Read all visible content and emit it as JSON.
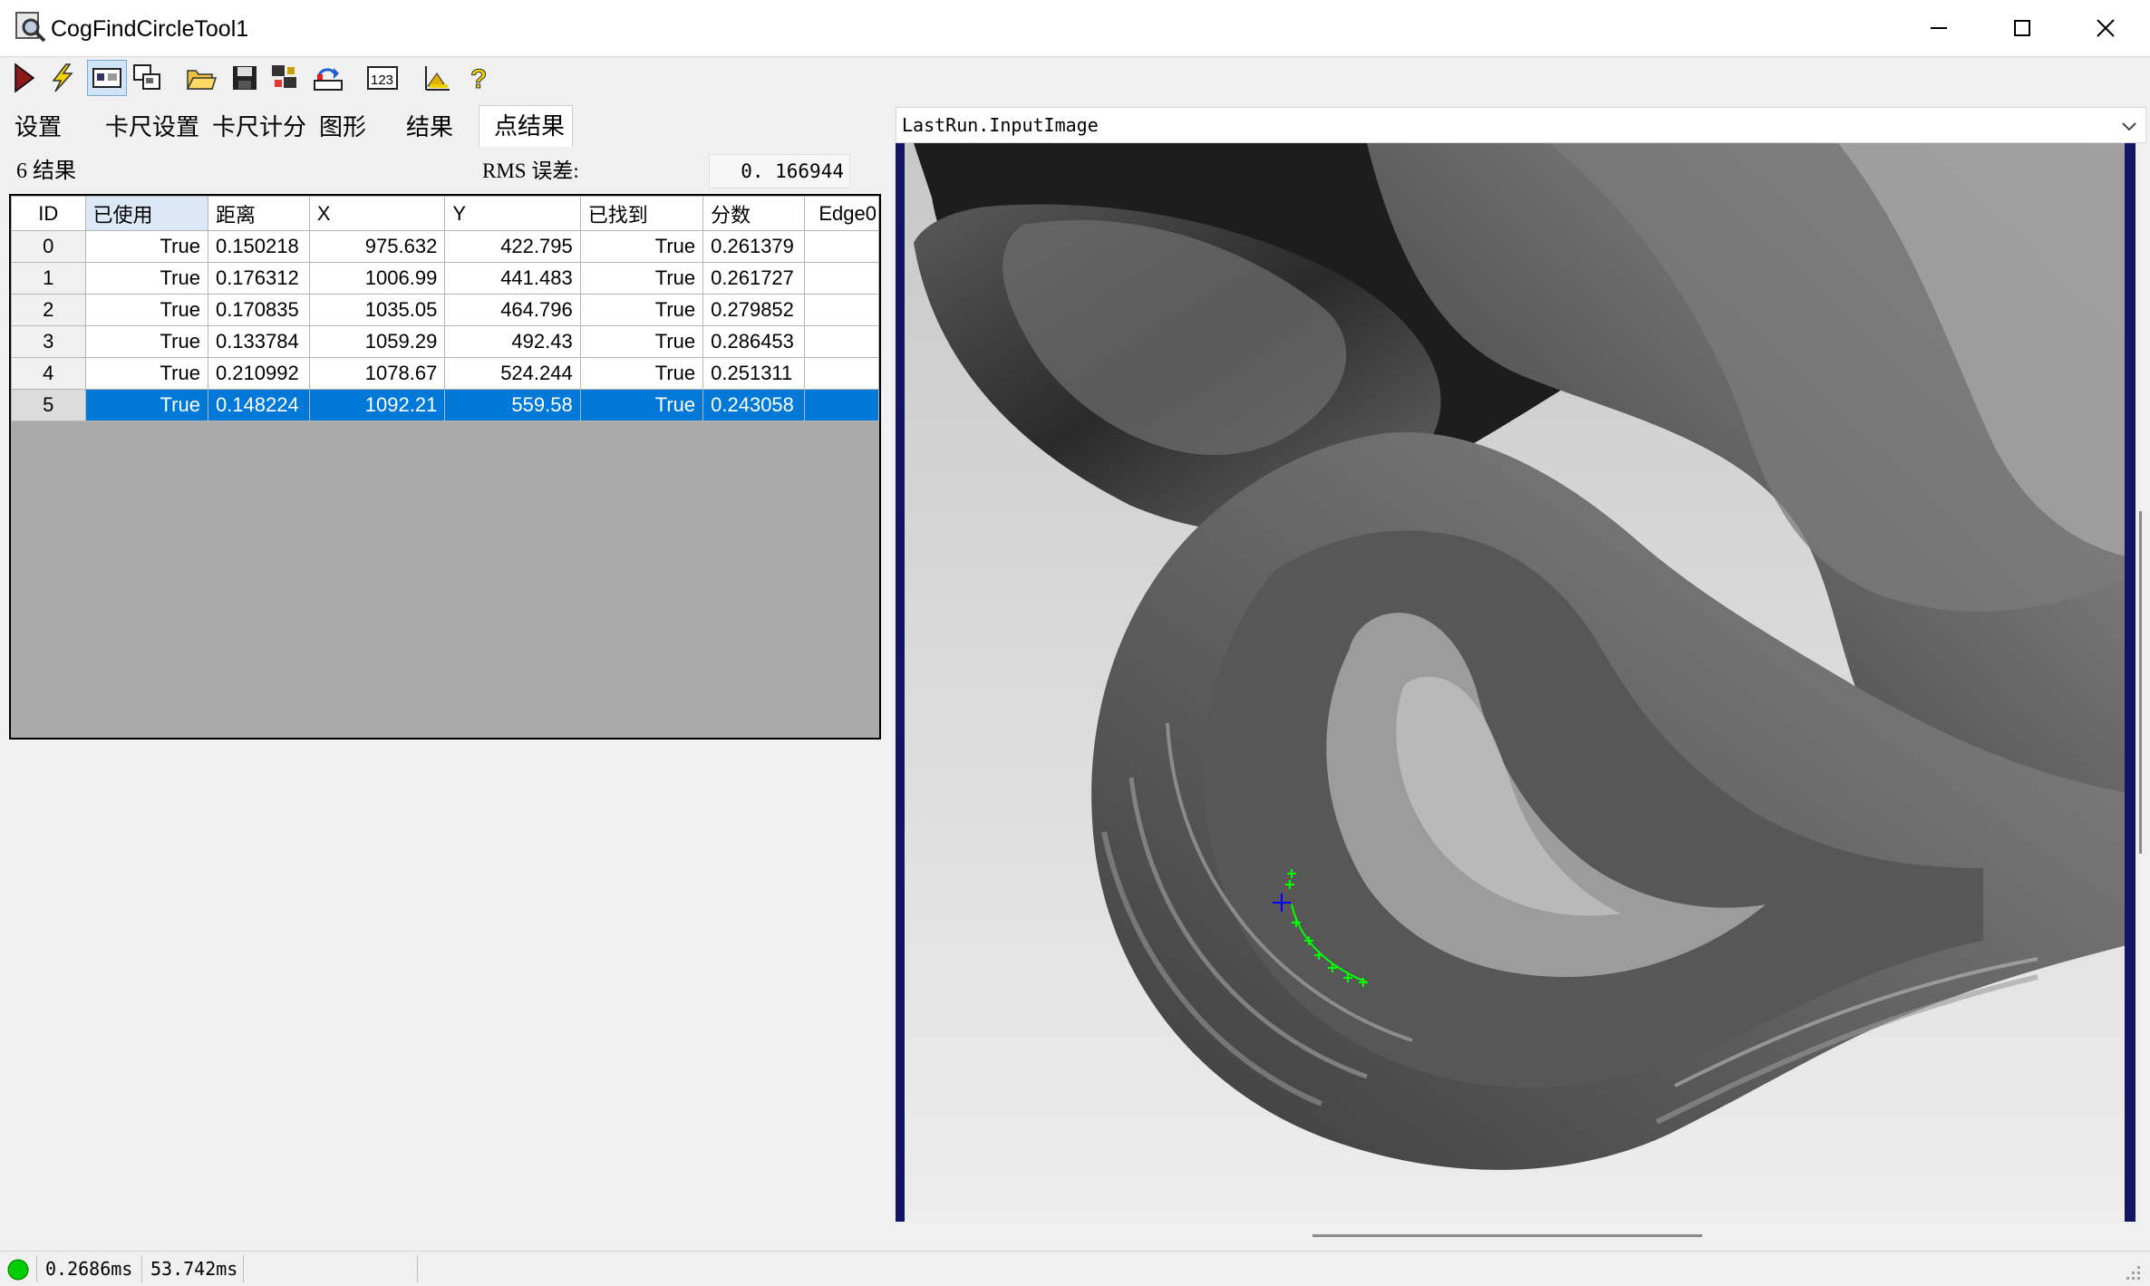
{
  "window": {
    "title": "CogFindCircleTool1",
    "controls": [
      "minimize",
      "maximize",
      "close"
    ]
  },
  "toolbar": {
    "buttons": [
      {
        "icon": "run-icon",
        "color": "#8b1a1a"
      },
      {
        "icon": "electric-icon",
        "color": "#f5d000"
      },
      {
        "icon": "display-icon",
        "pressed": true
      },
      {
        "icon": "floating-window-icon"
      },
      {
        "icon": "open-folder-icon"
      },
      {
        "icon": "save-icon"
      },
      {
        "icon": "reset-icon"
      },
      {
        "icon": "import-icon"
      },
      {
        "icon": "number-123-icon"
      },
      {
        "icon": "settings-chart-icon"
      },
      {
        "icon": "help-icon"
      }
    ]
  },
  "tabs": [
    "设置",
    "卡尺设置",
    "卡尺计分",
    "图形",
    "结果",
    "点结果"
  ],
  "active_tab": "点结果",
  "results": {
    "count_label": "6 结果",
    "rms_label": "RMS 误差:",
    "rms_value": "0. 166944"
  },
  "grid": {
    "columns": [
      "ID",
      "已使用",
      "距离",
      "X",
      "Y",
      "已找到",
      "分数",
      "Edge0"
    ],
    "sorted_column": "已使用",
    "rows": [
      [
        "0",
        "True",
        "0.150218",
        "975.632",
        "422.795",
        "True",
        "0.261379",
        ""
      ],
      [
        "1",
        "True",
        "0.176312",
        "1006.99",
        "441.483",
        "True",
        "0.261727",
        ""
      ],
      [
        "2",
        "True",
        "0.170835",
        "1035.05",
        "464.796",
        "True",
        "0.279852",
        ""
      ],
      [
        "3",
        "True",
        "0.133784",
        "1059.29",
        "492.43",
        "True",
        "0.286453",
        ""
      ],
      [
        "4",
        "True",
        "0.210992",
        "1078.67",
        "524.244",
        "True",
        "0.251311",
        ""
      ],
      [
        "5",
        "True",
        "0.148224",
        "1092.21",
        "559.58",
        "True",
        "0.243058",
        ""
      ]
    ],
    "selected_row": 5,
    "selection_color": "#0078d7"
  },
  "display": {
    "image_selector": "LastRun.InputImage",
    "border_color": "#141464",
    "edge_point_color": "#00ff00",
    "center_marker_color": "#0000ff"
  },
  "status": {
    "indicator_color": "#00cc00",
    "time1": "0.2686ms",
    "time2": "53.742ms"
  }
}
